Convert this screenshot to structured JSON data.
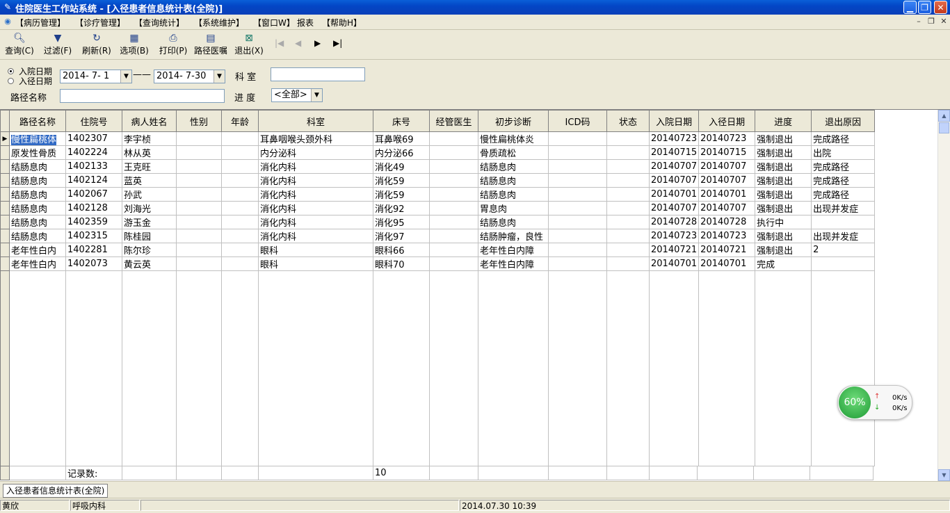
{
  "window": {
    "title": "住院医生工作站系统 - [入径患者信息统计表(全院)]"
  },
  "menu": [
    "【病历管理】",
    "【诊疗管理】",
    "【查询统计】",
    "【系统维护】",
    "【窗口W】",
    "报表",
    "【帮助H】"
  ],
  "toolbar": {
    "query": "查询(C)",
    "filter": "过滤(F)",
    "refresh": "刷新(R)",
    "options": "选项(B)",
    "print": "打印(P)",
    "path_order": "路径医嘱",
    "exit": "退出(X)"
  },
  "filters": {
    "radio_admit": "入院日期",
    "radio_path": "入径日期",
    "date_from": "2014- 7- 1",
    "date_sep": "——",
    "date_to": "2014- 7-30",
    "dept_label": "科    室",
    "dept_value": "",
    "path_name_label": "路径名称",
    "path_name_value": "",
    "progress_label": "进   度",
    "progress_value": "<全部>"
  },
  "grid": {
    "columns": [
      "路径名称",
      "住院号",
      "病人姓名",
      "性别",
      "年龄",
      "科室",
      "床号",
      "经管医生",
      "初步诊断",
      "ICD码",
      "状态",
      "入院日期",
      "入径日期",
      "进度",
      "退出原因"
    ],
    "rows": [
      [
        "慢性扁桃体",
        "1402307",
        "李宇桢",
        "",
        "",
        "耳鼻咽喉头颈外科",
        "耳鼻喉69",
        "",
        "慢性扁桃体炎",
        "",
        "",
        "20140723",
        "20140723",
        "强制退出",
        "完成路径"
      ],
      [
        "原发性骨质",
        "1402224",
        "林从英",
        "",
        "",
        "内分泌科",
        "内分泌66",
        "",
        "骨质疏松",
        "",
        "",
        "20140715",
        "20140715",
        "强制退出",
        "出院"
      ],
      [
        "结肠息肉",
        "1402133",
        "王克旺",
        "",
        "",
        "消化内科",
        "消化49",
        "",
        "结肠息肉",
        "",
        "",
        "20140707",
        "20140707",
        "强制退出",
        "完成路径"
      ],
      [
        "结肠息肉",
        "1402124",
        "蓝英",
        "",
        "",
        "消化内科",
        "消化59",
        "",
        "结肠息肉",
        "",
        "",
        "20140707",
        "20140707",
        "强制退出",
        "完成路径"
      ],
      [
        "结肠息肉",
        "1402067",
        "孙武",
        "",
        "",
        "消化内科",
        "消化59",
        "",
        "结肠息肉",
        "",
        "",
        "20140701",
        "20140701",
        "强制退出",
        "完成路径"
      ],
      [
        "结肠息肉",
        "1402128",
        "刘海光",
        "",
        "",
        "消化内科",
        "消化92",
        "",
        "胃息肉",
        "",
        "",
        "20140707",
        "20140707",
        "强制退出",
        "出现并发症"
      ],
      [
        "结肠息肉",
        "1402359",
        "游玉金",
        "",
        "",
        "消化内科",
        "消化95",
        "",
        "结肠息肉",
        "",
        "",
        "20140728",
        "20140728",
        "执行中",
        ""
      ],
      [
        "结肠息肉",
        "1402315",
        "陈桂园",
        "",
        "",
        "消化内科",
        "消化97",
        "",
        "结肠肿瘤，良性",
        "",
        "",
        "20140723",
        "20140723",
        "强制退出",
        "出现并发症"
      ],
      [
        "老年性白内",
        "1402281",
        "陈尔珍",
        "",
        "",
        "眼科",
        "眼科66",
        "",
        "老年性白内障",
        "",
        "",
        "20140721",
        "20140721",
        "强制退出",
        "2"
      ],
      [
        "老年性白内",
        "1402073",
        "黄云英",
        "",
        "",
        "眼科",
        "眼科70",
        "",
        "老年性白内障",
        "",
        "",
        "20140701",
        "20140701",
        "完成",
        ""
      ]
    ],
    "footer_label": "记录数:",
    "footer_count": "10"
  },
  "tab_label": "入径患者信息统计表(全院)",
  "status": {
    "user": "黄欣",
    "dept": "呼吸内科",
    "datetime": "2014.07.30 10:39"
  },
  "speed_widget": {
    "percent": "60%",
    "up": "0K/s",
    "down": "0K/s"
  }
}
